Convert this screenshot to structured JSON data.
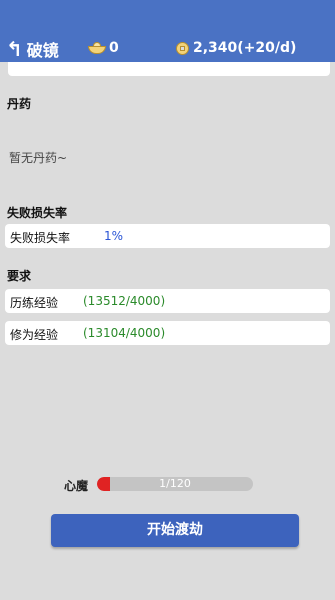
{
  "header": {
    "title": "破镜",
    "ingot_count": "0",
    "coin_text": "2,340(+20/d)"
  },
  "sections": {
    "elixir_title": "丹药",
    "elixir_empty": "暂无丹药~",
    "fail_title": "失败损失率",
    "fail_label": "失败损失率",
    "fail_value": "1%",
    "req_title": "要求",
    "requirements": [
      {
        "label": "历练经验",
        "value": "(13512/4000)"
      },
      {
        "label": "修为经验",
        "value": "(13104/4000)"
      }
    ]
  },
  "demon": {
    "label": "心魔",
    "text": "1/120",
    "progress": 0.0833
  },
  "start_button": "开始渡劫",
  "colors": {
    "header": "#4a72c4",
    "background": "#dcdcdc",
    "value_blue": "#2a55d6",
    "value_green": "#2a8a2a",
    "demon_fill": "#e02323",
    "button": "#3d63bd"
  },
  "icons": {
    "back": "back-arrow-icon",
    "ingot": "gold-ingot-icon",
    "coin": "copper-coin-icon"
  }
}
